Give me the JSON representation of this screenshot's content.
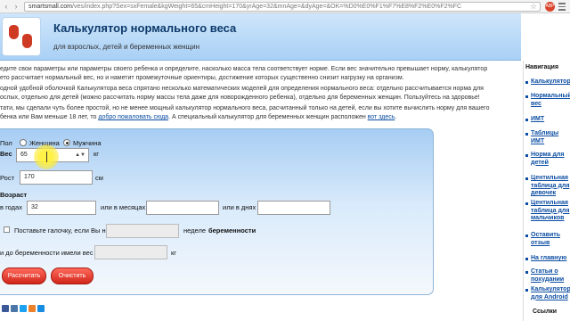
{
  "browser": {
    "url_host": "smartsmall.com",
    "url_rest": "/ves/index.php?Sex=sxFemale&kgWeight=65&cmHeight=170&yrAge=32&mnAge=&dyAge=&OK=%D0%E0%F1%F7%E8%F2%E0%F2%FC"
  },
  "header": {
    "title": "Калькулятор нормального веса",
    "subtitle": "для взрослых, детей и беременных женщин"
  },
  "intro": {
    "p1a": "едите свои параметры или параметры своего ребенка и определите, насколько масса тела соответствует норме. Если вес значительно превышает норму, калькулятор",
    "p1b": "ето рассчитает нормальный вес, но и наметит промежуточные ориентиры, достижение которых существенно снизит нагрузку на организм.",
    "p2a": "одной удобной оболочкой Калькулятора веса спрятано несколько математических моделей для определения нормального веса: отдельно рассчитывается норма для",
    "p2b": "ослых, отдельно для детей (можно рассчитать норму массы тела даже для новорожденного ребенка), отдельно для беременных женщин. Пользуйтесь на здоровье!",
    "p3a": "тати, мы сделали чуть более простой, но не менее мощный калькулятор нормального веса, расчитанный только на детей, если вы хотите вычислить норму для вашего",
    "p3b_pre": "бенка или Вам меньше 18 лет, то ",
    "p3b_link1": "добро пожаловать сюда",
    "p3b_mid": ". А специальный калькулятор для беременных женщин расположен ",
    "p3b_link2": "вот здесь",
    "p3b_end": "."
  },
  "form": {
    "sex_label": "Пол",
    "sex_female": "Женщина",
    "sex_male": "Мужчина",
    "weight_label": "Вес",
    "weight_value": "65",
    "weight_unit": "кг",
    "height_label": "Рост",
    "height_value": "170",
    "height_unit": "см",
    "age_label": "Возраст",
    "years_label": "в годах",
    "years_value": "32",
    "months_label": "или в месяцах",
    "days_label": "или в днях",
    "pregnancy_pre": "Поставьте галочку, если Вы на",
    "pregnancy_post": "неделе",
    "pregnancy_bold": "беременности",
    "prev_weight_label": "и до беременности имели вес",
    "prev_weight_unit": "кг",
    "calculate_button": "Рассчитать",
    "clear_button": "Очистить"
  },
  "sidebar": {
    "heading": "Навигация",
    "items": [
      "Калькулятор",
      "Нормальный вес",
      "ИМТ",
      "Таблицы ИМТ",
      "Норма для детей",
      "Центильная таблица для девочек",
      "Центильная таблица для мальчиков",
      "Оставить отзыв",
      "На главную",
      "Статьи о похудании",
      "Калькулятор для Android"
    ],
    "links_heading": "Ссылки"
  },
  "colors": {
    "title": "#0d3a6b",
    "button": "#d1261a",
    "link": "#0b4da2"
  }
}
